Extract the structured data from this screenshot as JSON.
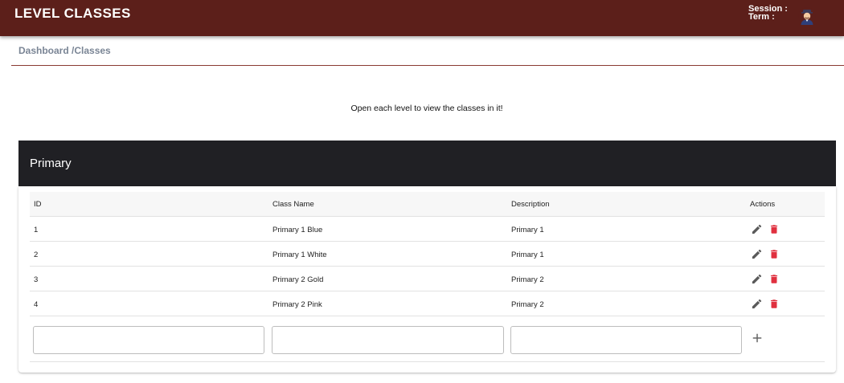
{
  "header": {
    "title": "LEVEL CLASSES",
    "session_label": "Session :",
    "term_label": "Term :"
  },
  "breadcrumb": "Dashboard /Classes",
  "hint": "Open each level to view the classes in it!",
  "level": {
    "name": "Primary",
    "columns": [
      "ID",
      "Class Name",
      "Description",
      "Actions"
    ],
    "rows": [
      {
        "id": "1",
        "class_name": "Primary 1 Blue",
        "description": "Primary 1"
      },
      {
        "id": "2",
        "class_name": "Primary 1 White",
        "description": "Primary 1"
      },
      {
        "id": "3",
        "class_name": "Primary 2 Gold",
        "description": "Primary 2"
      },
      {
        "id": "4",
        "class_name": "Primary 2 Pink",
        "description": "Primary 2"
      }
    ],
    "new_row": {
      "id_value": "",
      "name_value": "",
      "desc_value": "",
      "add_icon": "plus-icon"
    }
  },
  "colors": {
    "topbar": "#5c1f1a",
    "level_header": "#202024",
    "edit_icon": "#5a5a5a",
    "delete_icon": "#e0303f"
  }
}
